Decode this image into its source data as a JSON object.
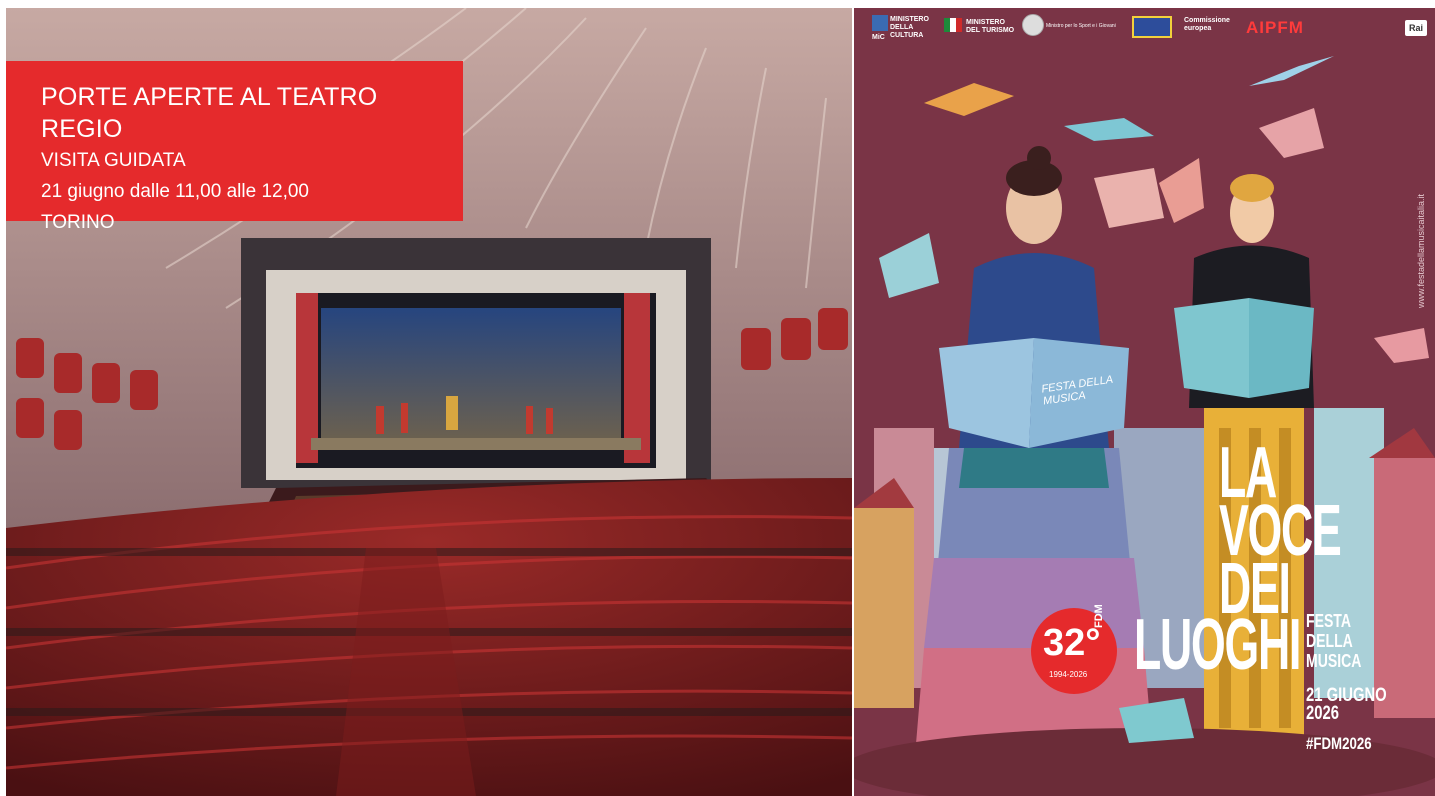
{
  "event_panel": {
    "title": "PORTE APERTE AL TEATRO REGIO",
    "type": "VISITA GUIDATA",
    "when": "21 giugno dalle 11,00 alle 12,00",
    "city": "TORINO"
  },
  "poster": {
    "logos": {
      "ministero_cultura": "MINISTERO DELLA CULTURA",
      "mic": "MiC",
      "ministero_turismo": "MINISTERO DEL TURISMO",
      "ministro_sport": "Ministro per lo Sport e i Giovani",
      "commissione": "Commissione europea",
      "aipfm": "AIPFM",
      "rai": "Rai"
    },
    "book_label": "FESTA DELLA MUSICA",
    "title_line1": "LA",
    "title_line2": "VOCE",
    "title_line3": "DEI",
    "title_line4": "LUOGHI",
    "subtitle_line1": "FESTA",
    "subtitle_line2": "DELLA",
    "subtitle_line3": "MUSICA",
    "date_line1": "21 GIUGNO",
    "date_line2": "2026",
    "hashtag": "#FDM2026",
    "badge_number": "32°",
    "badge_label": "FDM",
    "badge_years": "1994-2026",
    "url": "www.festadellamusicaitalia.it"
  },
  "colors": {
    "red": "#e52a2c",
    "poster_bg": "#7a3446",
    "theatre_red": "#8c1e22"
  }
}
